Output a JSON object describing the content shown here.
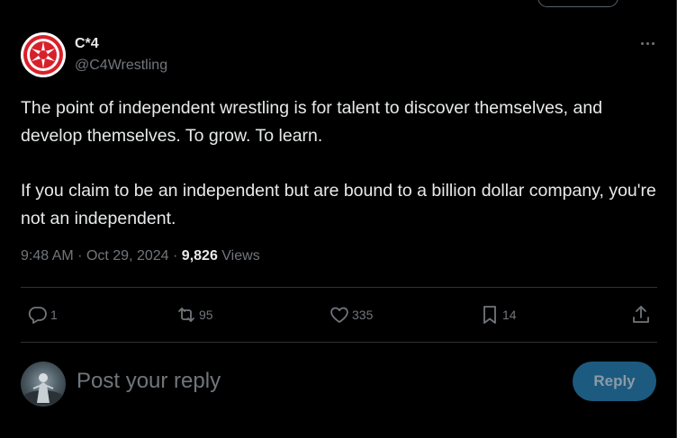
{
  "tweet": {
    "author_name": "C*4",
    "author_handle": "@C4Wrestling",
    "paragraphs": [
      "The point of independent wrestling is for talent to discover themselves, and develop themselves. To grow. To learn.",
      "If you claim to be an independent but are bound to a billion dollar company, you're not an independent."
    ],
    "time": "9:48 AM",
    "date": "Oct 29, 2024",
    "views_count": "9,826",
    "views_label": "Views",
    "separator": "·"
  },
  "actions": {
    "replies": "1",
    "reposts": "95",
    "likes": "335",
    "bookmarks": "14"
  },
  "reply_box": {
    "placeholder": "Post your reply",
    "button_label": "Reply"
  },
  "icons": {
    "more": "more-icon",
    "reply": "reply-icon",
    "repost": "repost-icon",
    "like": "heart-icon",
    "bookmark": "bookmark-icon",
    "share": "share-icon"
  },
  "colors": {
    "background": "#000000",
    "text": "#e7e9ea",
    "muted": "#71767b",
    "reply_button": "#1d5a7f",
    "brand_red": "#d8202a"
  }
}
